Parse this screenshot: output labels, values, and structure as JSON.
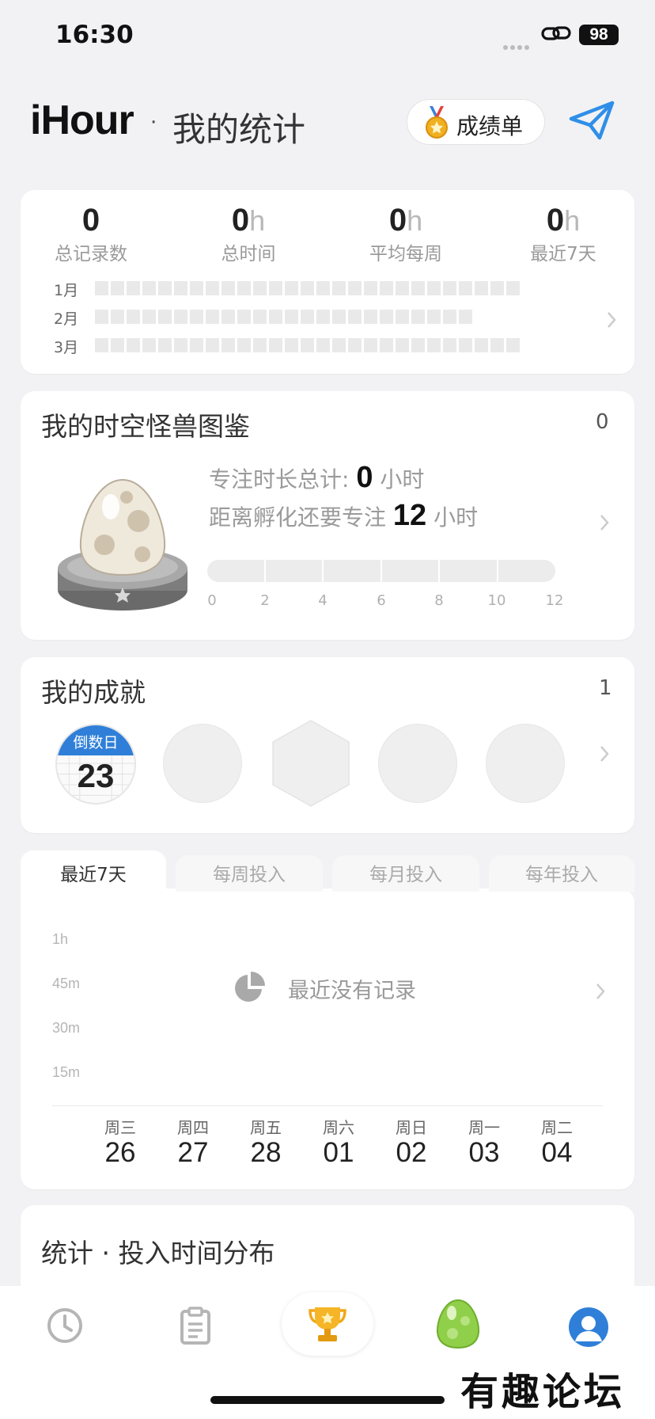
{
  "status_bar": {
    "time": "16:30",
    "battery": "98"
  },
  "header": {
    "app_name": "iHour",
    "separator": "·",
    "title": "我的统计",
    "report_button": "成绩单"
  },
  "summary": {
    "stats": [
      {
        "value": "0",
        "unit": "",
        "label": "总记录数"
      },
      {
        "value": "0",
        "unit": "h",
        "label": "总时间"
      },
      {
        "value": "0",
        "unit": "h",
        "label": "平均每周"
      },
      {
        "value": "0",
        "unit": "h",
        "label": "最近7天"
      }
    ],
    "months": [
      "1月",
      "2月",
      "3月"
    ]
  },
  "monster": {
    "title": "我的时空怪兽图鉴",
    "count": "0",
    "total_prefix": "专注时长总计:",
    "total_value": "0",
    "total_unit": "小时",
    "hatch_prefix": "距离孵化还要专注",
    "hatch_value": "12",
    "hatch_unit": "小时",
    "progress": 0,
    "ticks": [
      "0",
      "2",
      "4",
      "6",
      "8",
      "10",
      "12"
    ]
  },
  "achievements": {
    "title": "我的成就",
    "count": "1",
    "badge_label": "倒数日",
    "badge_number": "23"
  },
  "tabs": [
    "最近7天",
    "每周投入",
    "每月投入",
    "每年投入"
  ],
  "chart": {
    "y_labels": [
      "1h",
      "45m",
      "30m",
      "15m"
    ],
    "empty_text": "最近没有记录",
    "days": [
      {
        "weekday": "周三",
        "date": "26"
      },
      {
        "weekday": "周四",
        "date": "27"
      },
      {
        "weekday": "周五",
        "date": "28"
      },
      {
        "weekday": "周六",
        "date": "01"
      },
      {
        "weekday": "周日",
        "date": "02"
      },
      {
        "weekday": "周一",
        "date": "03"
      },
      {
        "weekday": "周二",
        "date": "04"
      }
    ]
  },
  "distribution": {
    "title": "统计 · 投入时间分布"
  },
  "watermark": "有趣论坛",
  "colors": {
    "accent": "#2f8fe8",
    "trophy": "#f0a818",
    "egg": "#8fcf4a"
  }
}
